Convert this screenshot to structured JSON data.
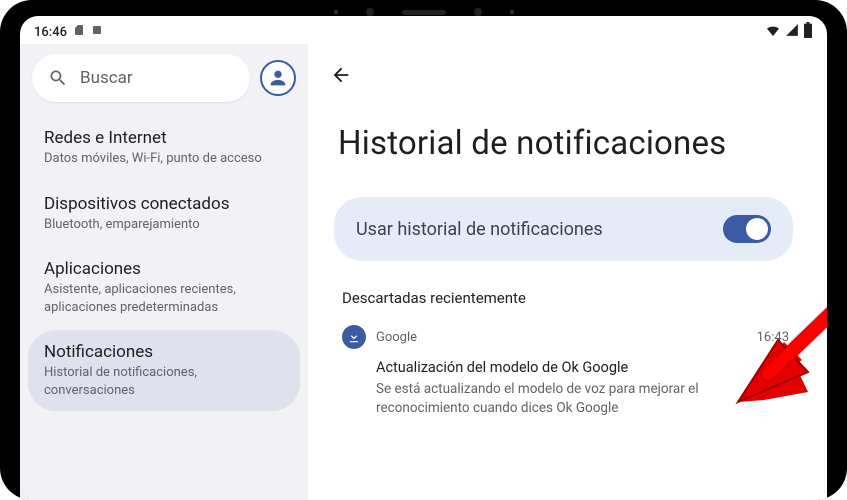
{
  "status": {
    "time": "16:46"
  },
  "search": {
    "placeholder": "Buscar"
  },
  "sidebar": {
    "items": [
      {
        "title": "Redes e Internet",
        "sub": "Datos móviles, Wi-Fi, punto de acceso"
      },
      {
        "title": "Dispositivos conectados",
        "sub": "Bluetooth, emparejamiento"
      },
      {
        "title": "Aplicaciones",
        "sub": "Asistente, aplicaciones recientes, aplicaciones predeterminadas"
      },
      {
        "title": "Notificaciones",
        "sub": "Historial de notificaciones, conversaciones"
      }
    ]
  },
  "main": {
    "page_title": "Historial de notificaciones",
    "toggle_label": "Usar historial de notificaciones",
    "section_header": "Descartadas recientemente",
    "notification": {
      "app": "Google",
      "time": "16:43",
      "title": "Actualización del modelo de Ok Google",
      "text": "Se está actualizando el modelo de voz para mejorar el reconocimiento cuando dices Ok Google"
    }
  },
  "colors": {
    "accent": "#3b5ba5",
    "bg_soft": "#e6ecf7"
  }
}
